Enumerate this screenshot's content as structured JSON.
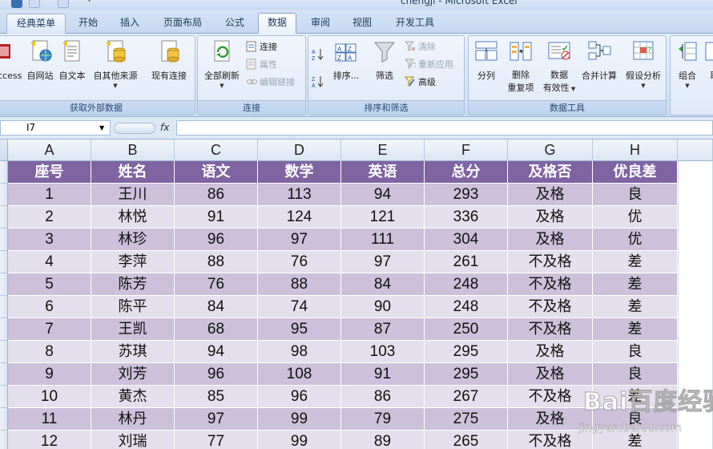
{
  "window": {
    "title": "chengji - Microsoft Excel"
  },
  "tabs": [
    {
      "label": "经典菜单"
    },
    {
      "label": "开始"
    },
    {
      "label": "插入"
    },
    {
      "label": "页面布局"
    },
    {
      "label": "公式"
    },
    {
      "label": "数据"
    },
    {
      "label": "审阅"
    },
    {
      "label": "视图"
    },
    {
      "label": "开发工具"
    }
  ],
  "active_tab": "数据",
  "ribbon": {
    "groups": {
      "external": {
        "label": "获取外部数据",
        "buttons": [
          {
            "label": "ccess",
            "icon": "access-icon"
          },
          {
            "label": "自网站",
            "icon": "web-globe-icon"
          },
          {
            "label": "自文本",
            "icon": "text-file-icon"
          },
          {
            "label": "自其他来源",
            "icon": "other-sources-icon"
          },
          {
            "label": "现有连接",
            "icon": "existing-connections-icon"
          }
        ]
      },
      "connections": {
        "label": "连接",
        "refresh_label": "全部刷新",
        "small": [
          {
            "label": "连接",
            "enabled": true
          },
          {
            "label": "属性",
            "enabled": false
          },
          {
            "label": "编辑链接",
            "enabled": false
          }
        ]
      },
      "sort_filter": {
        "label": "排序和筛选",
        "sort_label": "排序...",
        "filter_label": "筛选",
        "small": [
          {
            "label": "清除",
            "enabled": false
          },
          {
            "label": "重新应用",
            "enabled": false
          },
          {
            "label": "高级",
            "enabled": true
          }
        ]
      },
      "data_tools": {
        "label": "数据工具",
        "buttons": [
          {
            "label": "分列",
            "label2": ""
          },
          {
            "label": "删除",
            "label2": "重复项"
          },
          {
            "label": "数据",
            "label2": "有效性"
          },
          {
            "label": "合并计算",
            "label2": ""
          },
          {
            "label": "假设分析",
            "label2": ""
          }
        ]
      },
      "outline": {
        "buttons": [
          {
            "label": "组合"
          },
          {
            "label": "取"
          }
        ]
      }
    }
  },
  "formula_bar": {
    "name_box": "I7",
    "fx_label": "fx",
    "formula": ""
  },
  "sheet": {
    "columns": [
      "A",
      "B",
      "C",
      "D",
      "E",
      "F",
      "G",
      "H"
    ],
    "rows": [
      [
        "座号",
        "姓名",
        "语文",
        "数学",
        "英语",
        "总分",
        "及格否",
        "优良差"
      ],
      [
        "1",
        "王川",
        "86",
        "113",
        "94",
        "293",
        "及格",
        "良"
      ],
      [
        "2",
        "林悦",
        "91",
        "124",
        "121",
        "336",
        "及格",
        "优"
      ],
      [
        "3",
        "林珍",
        "96",
        "97",
        "111",
        "304",
        "及格",
        "优"
      ],
      [
        "4",
        "李萍",
        "88",
        "76",
        "97",
        "261",
        "不及格",
        "差"
      ],
      [
        "5",
        "陈芳",
        "76",
        "88",
        "84",
        "248",
        "不及格",
        "差"
      ],
      [
        "6",
        "陈平",
        "84",
        "74",
        "90",
        "248",
        "不及格",
        "差"
      ],
      [
        "7",
        "王凯",
        "68",
        "95",
        "87",
        "250",
        "不及格",
        "差"
      ],
      [
        "8",
        "苏琪",
        "94",
        "98",
        "103",
        "295",
        "及格",
        "良"
      ],
      [
        "9",
        "刘芳",
        "96",
        "108",
        "91",
        "295",
        "及格",
        "良"
      ],
      [
        "10",
        "黄杰",
        "85",
        "96",
        "86",
        "267",
        "不及格",
        "差"
      ],
      [
        "11",
        "林丹",
        "97",
        "99",
        "79",
        "275",
        "及格",
        "良"
      ],
      [
        "12",
        "刘瑞",
        "77",
        "99",
        "89",
        "265",
        "不及格",
        "差"
      ]
    ]
  },
  "watermark": {
    "logo": "Bai百度经验",
    "url": "jingyan.baidu.com"
  },
  "colors": {
    "header_fill": "#8064a2",
    "band_dark": "#ccc0da",
    "band_light": "#e4dfec"
  }
}
